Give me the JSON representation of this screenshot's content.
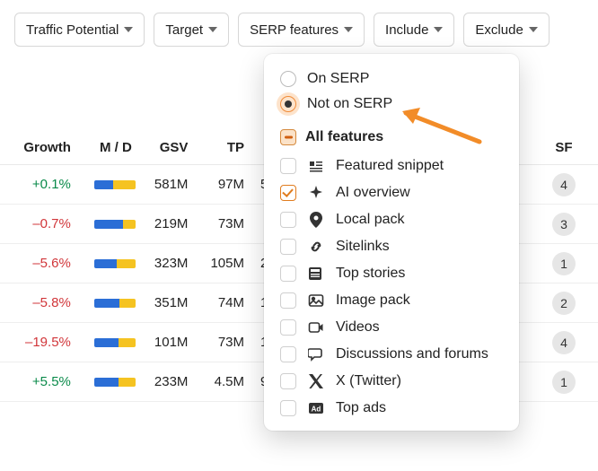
{
  "filters": {
    "traffic_potential": "Traffic Potential",
    "target": "Target",
    "serp_features": "SERP features",
    "include": "Include",
    "exclude": "Exclude"
  },
  "table": {
    "headers": {
      "growth": "Growth",
      "md": "M / D",
      "gsv": "GSV",
      "tp": "TP",
      "sf": "SF"
    },
    "rows": [
      {
        "growth": "+0.1%",
        "growth_sign": "pos",
        "m_ratio": 0.45,
        "gsv": "581M",
        "tp": "97M",
        "extra": "5",
        "sf": "4"
      },
      {
        "growth": "–0.7%",
        "growth_sign": "neg",
        "m_ratio": 0.7,
        "gsv": "219M",
        "tp": "73M",
        "extra": "",
        "sf": "3"
      },
      {
        "growth": "–5.6%",
        "growth_sign": "neg",
        "m_ratio": 0.55,
        "gsv": "323M",
        "tp": "105M",
        "extra": "2",
        "sf": "1"
      },
      {
        "growth": "–5.8%",
        "growth_sign": "neg",
        "m_ratio": 0.62,
        "gsv": "351M",
        "tp": "74M",
        "extra": "1",
        "sf": "2"
      },
      {
        "growth": "–19.5%",
        "growth_sign": "neg",
        "m_ratio": 0.6,
        "gsv": "101M",
        "tp": "73M",
        "extra": "1",
        "sf": "4"
      },
      {
        "growth": "+5.5%",
        "growth_sign": "pos",
        "m_ratio": 0.58,
        "gsv": "233M",
        "tp": "4.5M",
        "extra": "9",
        "sf": "1"
      }
    ]
  },
  "dropdown": {
    "on_serp": "On SERP",
    "not_on_serp": "Not on SERP",
    "selected_radio": "not_on_serp",
    "all_features": "All features",
    "features": [
      {
        "id": "featured-snippet",
        "label": "Featured snippet",
        "checked": false
      },
      {
        "id": "ai-overview",
        "label": "AI overview",
        "checked": true
      },
      {
        "id": "local-pack",
        "label": "Local pack",
        "checked": false
      },
      {
        "id": "sitelinks",
        "label": "Sitelinks",
        "checked": false
      },
      {
        "id": "top-stories",
        "label": "Top stories",
        "checked": false
      },
      {
        "id": "image-pack",
        "label": "Image pack",
        "checked": false
      },
      {
        "id": "videos",
        "label": "Videos",
        "checked": false
      },
      {
        "id": "discussions",
        "label": "Discussions and forums",
        "checked": false
      },
      {
        "id": "x-twitter",
        "label": "X (Twitter)",
        "checked": false
      },
      {
        "id": "top-ads",
        "label": "Top ads",
        "checked": false
      }
    ]
  }
}
